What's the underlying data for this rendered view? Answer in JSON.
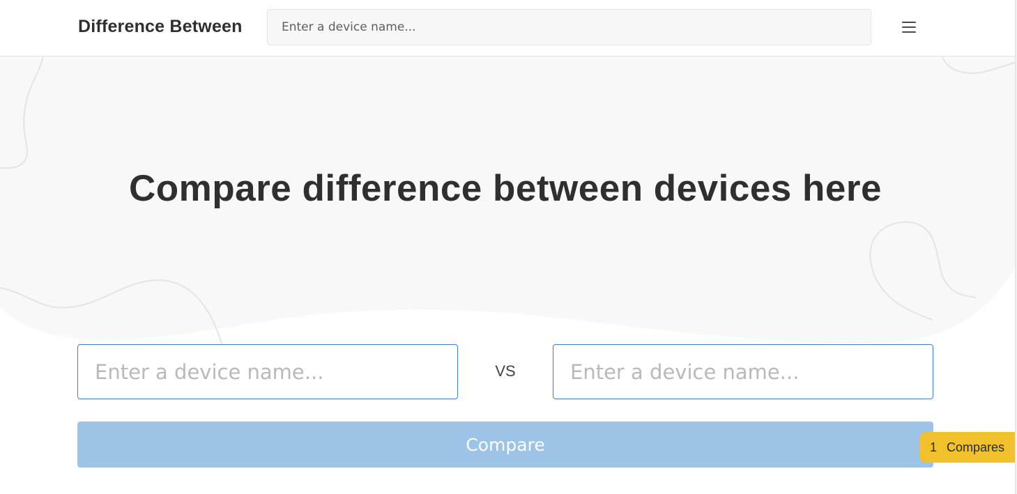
{
  "header": {
    "brand": "Difference Between",
    "search_placeholder": "Enter a device name...",
    "menu_icon": "hamburger-menu-icon"
  },
  "hero": {
    "title": "Compare difference between devices here"
  },
  "compare_form": {
    "left_placeholder": "Enter a device name...",
    "vs_label": "VS",
    "right_placeholder": "Enter a device name...",
    "button_label": "Compare"
  },
  "compares_badge": {
    "count": "1",
    "label": "Compares"
  },
  "colors": {
    "hero_bg": "#f8f8f8",
    "input_border": "#3d7fc4",
    "button_bg": "#9dc4e6",
    "badge_bg": "#f0c02d",
    "text_dark": "#2f2f2f"
  }
}
